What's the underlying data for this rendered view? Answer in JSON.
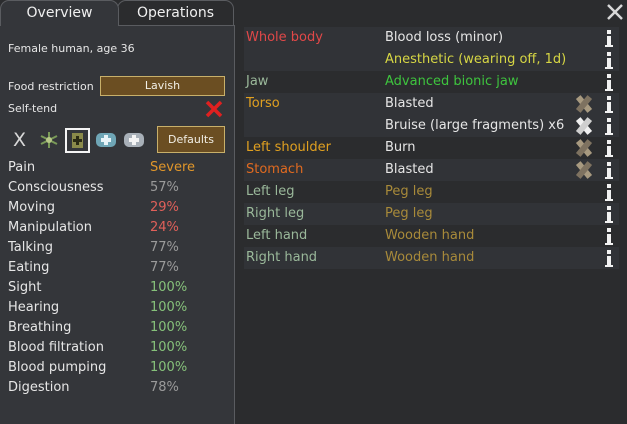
{
  "tabs": {
    "overview": "Overview",
    "operations": "Operations"
  },
  "summary": "Female human, age 36",
  "food_restriction": {
    "label": "Food restriction",
    "value": "Lavish"
  },
  "self_tend": {
    "label": "Self-tend"
  },
  "defaults_button": "Defaults",
  "x_glyph": "X",
  "capacities": [
    {
      "name": "Pain",
      "value": "Severe",
      "color": "#e0962a"
    },
    {
      "name": "Consciousness",
      "value": "57%",
      "color": "#9a9a9a"
    },
    {
      "name": "Moving",
      "value": "29%",
      "color": "#e0605a"
    },
    {
      "name": "Manipulation",
      "value": "24%",
      "color": "#e0605a"
    },
    {
      "name": "Talking",
      "value": "77%",
      "color": "#9a9a9a"
    },
    {
      "name": "Eating",
      "value": "77%",
      "color": "#9a9a9a"
    },
    {
      "name": "Sight",
      "value": "100%",
      "color": "#86c17a"
    },
    {
      "name": "Hearing",
      "value": "100%",
      "color": "#86c17a"
    },
    {
      "name": "Breathing",
      "value": "100%",
      "color": "#86c17a"
    },
    {
      "name": "Blood filtration",
      "value": "100%",
      "color": "#86c17a"
    },
    {
      "name": "Blood pumping",
      "value": "100%",
      "color": "#86c17a"
    },
    {
      "name": "Digestion",
      "value": "78%",
      "color": "#9a9a9a"
    }
  ],
  "hediffs": [
    {
      "part": "Whole body",
      "part_color": "#e04848",
      "conditions": [
        {
          "text": "Blood loss (minor)",
          "color": "#e6e6e6"
        },
        {
          "text": "Anesthetic (wearing off, 1d)",
          "color": "#d6d644"
        }
      ]
    },
    {
      "part": "Jaw",
      "part_color": "#9ab89a",
      "conditions": [
        {
          "text": "Advanced bionic jaw",
          "color": "#3ec43e"
        }
      ]
    },
    {
      "part": "Torso",
      "part_color": "#e0a020",
      "conditions": [
        {
          "text": "Blasted",
          "color": "#e6e6e6",
          "bandage": "tended"
        },
        {
          "text": "Bruise (large fragments) x6",
          "color": "#e6e6e6",
          "bandage": "fresh"
        }
      ]
    },
    {
      "part": "Left shoulder",
      "part_color": "#e0a020",
      "conditions": [
        {
          "text": "Burn",
          "color": "#e6e6e6",
          "bandage": "tended"
        }
      ]
    },
    {
      "part": "Stomach",
      "part_color": "#e06a20",
      "conditions": [
        {
          "text": "Blasted",
          "color": "#e6e6e6",
          "bandage": "tended"
        }
      ]
    },
    {
      "part": "Left leg",
      "part_color": "#9ab89a",
      "conditions": [
        {
          "text": "Peg leg",
          "color": "#a88a3a"
        }
      ]
    },
    {
      "part": "Right leg",
      "part_color": "#9ab89a",
      "conditions": [
        {
          "text": "Peg leg",
          "color": "#a88a3a"
        }
      ]
    },
    {
      "part": "Left hand",
      "part_color": "#9ab89a",
      "conditions": [
        {
          "text": "Wooden hand",
          "color": "#a88a3a"
        }
      ]
    },
    {
      "part": "Right hand",
      "part_color": "#9ab89a",
      "conditions": [
        {
          "text": "Wooden hand",
          "color": "#a88a3a"
        }
      ]
    }
  ]
}
